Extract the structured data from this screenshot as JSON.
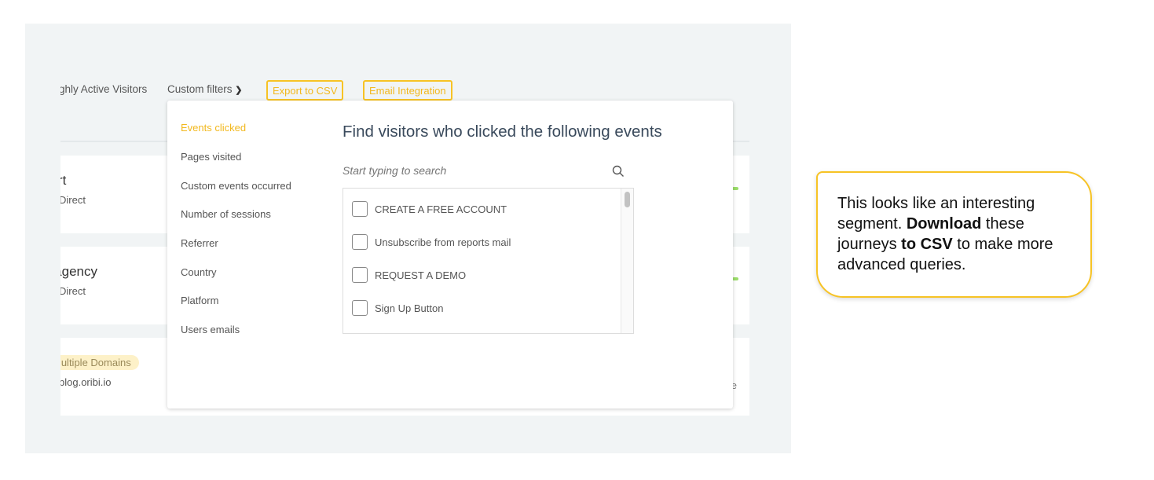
{
  "toolbar": {
    "tab_active_visitors": "ghly Active Visitors",
    "custom_filters": "Custom filters",
    "export_csv": "Export to CSV",
    "email_integration": "Email Integration"
  },
  "rows": [
    {
      "name": "bert",
      "source": "Direct"
    },
    {
      "name": "n.agency",
      "source": "Direct"
    },
    {
      "badge": "Multiple Domains",
      "source": "blog.oribi.io",
      "extra": "e"
    }
  ],
  "dropdown": {
    "menu": [
      "Events clicked",
      "Pages visited",
      "Custom events occurred",
      "Number of sessions",
      "Referrer",
      "Country",
      "Platform",
      "Users emails"
    ],
    "title": "Find visitors who clicked the following events",
    "search_placeholder": "Start typing to search",
    "events": [
      "CREATE A FREE ACCOUNT",
      "Unsubscribe from reports mail",
      "REQUEST A DEMO",
      "Sign Up Button"
    ]
  },
  "callout": {
    "t1": "This looks like an interesting segment. ",
    "b1": "Download",
    "t2": " these journeys ",
    "b2": "to CSV",
    "t3": " to make more advanced queries."
  },
  "colors": {
    "accent": "#f7c325",
    "background": "#f1f4f5"
  }
}
